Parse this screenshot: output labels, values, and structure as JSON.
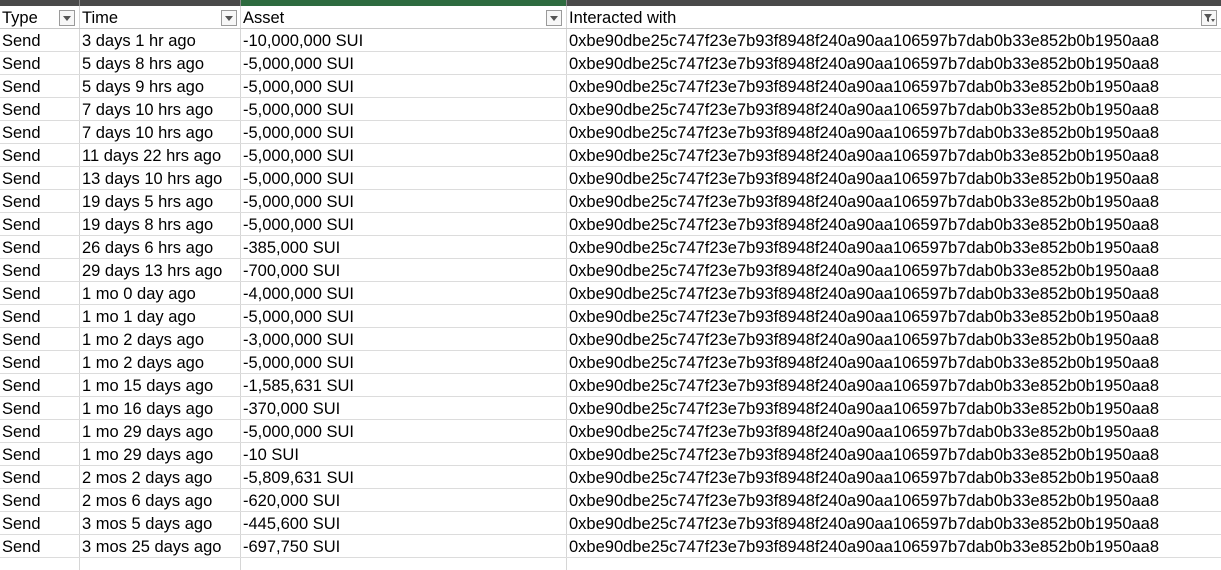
{
  "sheet": {
    "columns": [
      {
        "label": "Type",
        "filter": "dropdown"
      },
      {
        "label": "Time",
        "filter": "dropdown"
      },
      {
        "label": "Asset",
        "filter": "dropdown"
      },
      {
        "label": "Interacted with",
        "filter": "filtered"
      }
    ],
    "rows": [
      [
        "Send",
        "3 days 1 hr ago",
        "-10,000,000 SUI",
        "0xbe90dbe25c747f23e7b93f8948f240a90aa106597b7dab0b33e852b0b1950aa8"
      ],
      [
        "Send",
        "5 days 8 hrs ago",
        "-5,000,000 SUI",
        "0xbe90dbe25c747f23e7b93f8948f240a90aa106597b7dab0b33e852b0b1950aa8"
      ],
      [
        "Send",
        "5 days 9 hrs ago",
        "-5,000,000 SUI",
        "0xbe90dbe25c747f23e7b93f8948f240a90aa106597b7dab0b33e852b0b1950aa8"
      ],
      [
        "Send",
        "7 days 10 hrs ago",
        "-5,000,000 SUI",
        "0xbe90dbe25c747f23e7b93f8948f240a90aa106597b7dab0b33e852b0b1950aa8"
      ],
      [
        "Send",
        "7 days 10 hrs ago",
        "-5,000,000 SUI",
        "0xbe90dbe25c747f23e7b93f8948f240a90aa106597b7dab0b33e852b0b1950aa8"
      ],
      [
        "Send",
        "11 days 22 hrs ago",
        "-5,000,000 SUI",
        "0xbe90dbe25c747f23e7b93f8948f240a90aa106597b7dab0b33e852b0b1950aa8"
      ],
      [
        "Send",
        "13 days 10 hrs ago",
        "-5,000,000 SUI",
        "0xbe90dbe25c747f23e7b93f8948f240a90aa106597b7dab0b33e852b0b1950aa8"
      ],
      [
        "Send",
        "19 days 5 hrs ago",
        "-5,000,000 SUI",
        "0xbe90dbe25c747f23e7b93f8948f240a90aa106597b7dab0b33e852b0b1950aa8"
      ],
      [
        "Send",
        "19 days 8 hrs ago",
        "-5,000,000 SUI",
        "0xbe90dbe25c747f23e7b93f8948f240a90aa106597b7dab0b33e852b0b1950aa8"
      ],
      [
        "Send",
        "26 days 6 hrs ago",
        "-385,000 SUI",
        "0xbe90dbe25c747f23e7b93f8948f240a90aa106597b7dab0b33e852b0b1950aa8"
      ],
      [
        "Send",
        "29 days 13 hrs ago",
        "-700,000 SUI",
        "0xbe90dbe25c747f23e7b93f8948f240a90aa106597b7dab0b33e852b0b1950aa8"
      ],
      [
        "Send",
        "1 mo 0 day ago",
        "-4,000,000 SUI",
        "0xbe90dbe25c747f23e7b93f8948f240a90aa106597b7dab0b33e852b0b1950aa8"
      ],
      [
        "Send",
        "1 mo 1 day ago",
        "-5,000,000 SUI",
        "0xbe90dbe25c747f23e7b93f8948f240a90aa106597b7dab0b33e852b0b1950aa8"
      ],
      [
        "Send",
        "1 mo 2 days ago",
        "-3,000,000 SUI",
        "0xbe90dbe25c747f23e7b93f8948f240a90aa106597b7dab0b33e852b0b1950aa8"
      ],
      [
        "Send",
        "1 mo 2 days ago",
        "-5,000,000 SUI",
        "0xbe90dbe25c747f23e7b93f8948f240a90aa106597b7dab0b33e852b0b1950aa8"
      ],
      [
        "Send",
        "1 mo 15 days ago",
        "-1,585,631 SUI",
        "0xbe90dbe25c747f23e7b93f8948f240a90aa106597b7dab0b33e852b0b1950aa8"
      ],
      [
        "Send",
        "1 mo 16 days ago",
        "-370,000 SUI",
        "0xbe90dbe25c747f23e7b93f8948f240a90aa106597b7dab0b33e852b0b1950aa8"
      ],
      [
        "Send",
        "1 mo 29 days ago",
        "-5,000,000 SUI",
        "0xbe90dbe25c747f23e7b93f8948f240a90aa106597b7dab0b33e852b0b1950aa8"
      ],
      [
        "Send",
        "1 mo 29 days ago",
        "-10 SUI",
        "0xbe90dbe25c747f23e7b93f8948f240a90aa106597b7dab0b33e852b0b1950aa8"
      ],
      [
        "Send",
        "2 mos 2 days ago",
        "-5,809,631 SUI",
        "0xbe90dbe25c747f23e7b93f8948f240a90aa106597b7dab0b33e852b0b1950aa8"
      ],
      [
        "Send",
        "2 mos 6 days ago",
        "-620,000 SUI",
        "0xbe90dbe25c747f23e7b93f8948f240a90aa106597b7dab0b33e852b0b1950aa8"
      ],
      [
        "Send",
        "3 mos 5 days ago",
        "-445,600 SUI",
        "0xbe90dbe25c747f23e7b93f8948f240a90aa106597b7dab0b33e852b0b1950aa8"
      ],
      [
        "Send",
        "3 mos 25 days ago",
        "-697,750 SUI",
        "0xbe90dbe25c747f23e7b93f8948f240a90aa106597b7dab0b33e852b0b1950aa8"
      ]
    ]
  },
  "colors": {
    "selected_column_accent": "#2e6b3f",
    "top_strip": "#4a4a4a",
    "gridline": "#d6d6d6"
  }
}
